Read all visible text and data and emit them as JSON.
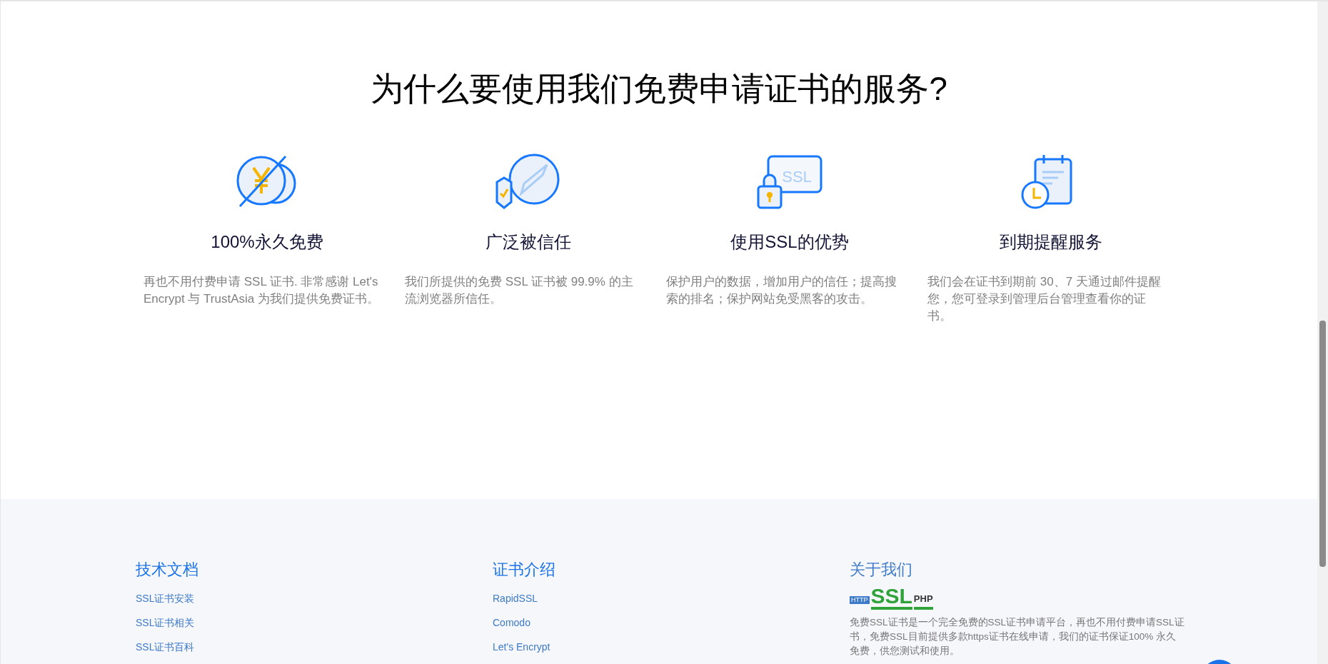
{
  "heading": "为什么要使用我们免费申请证书的服务?",
  "features": [
    {
      "kind": "free",
      "title": "100%永久免费",
      "description": "再也不用付费申请 SSL 证书. 非常感谢 Let's Encrypt 与 TrustAsia 为我们提供免费证书。"
    },
    {
      "kind": "trust",
      "title": "广泛被信任",
      "description": "我们所提供的免费 SSL 证书被 99.9% 的主流浏览器所信任。"
    },
    {
      "kind": "ssl",
      "title": "使用SSL的优势",
      "description": "保护用户的数据，增加用户的信任；提高搜索的排名；保护网站免受黑客的攻击。",
      "icon_text": "SSL"
    },
    {
      "kind": "reminder",
      "title": "到期提醒服务",
      "description": "我们会在证书到期前 30、7 天通过邮件提醒您，您可登录到管理后台管理查看你的证书。"
    }
  ],
  "footer": {
    "columns": [
      {
        "title": "技术文档",
        "links": [
          "SSL证书安装",
          "SSL证书相关",
          "SSL证书百科"
        ]
      },
      {
        "title": "证书介绍",
        "links": [
          "RapidSSL",
          "Comodo",
          "Let's Encrypt"
        ]
      }
    ],
    "about": {
      "title": "关于我们",
      "logo": {
        "badge": "HTTP",
        "big": "SSL",
        "small": "PHP"
      },
      "text": "免费SSL证书是一个完全免费的SSL证书申请平台，再也不用付费申请SSL证书，免费SSL目前提供多款https证书在线申请，我们的证书保证100% 永久免费，供您测试和使用。"
    }
  }
}
